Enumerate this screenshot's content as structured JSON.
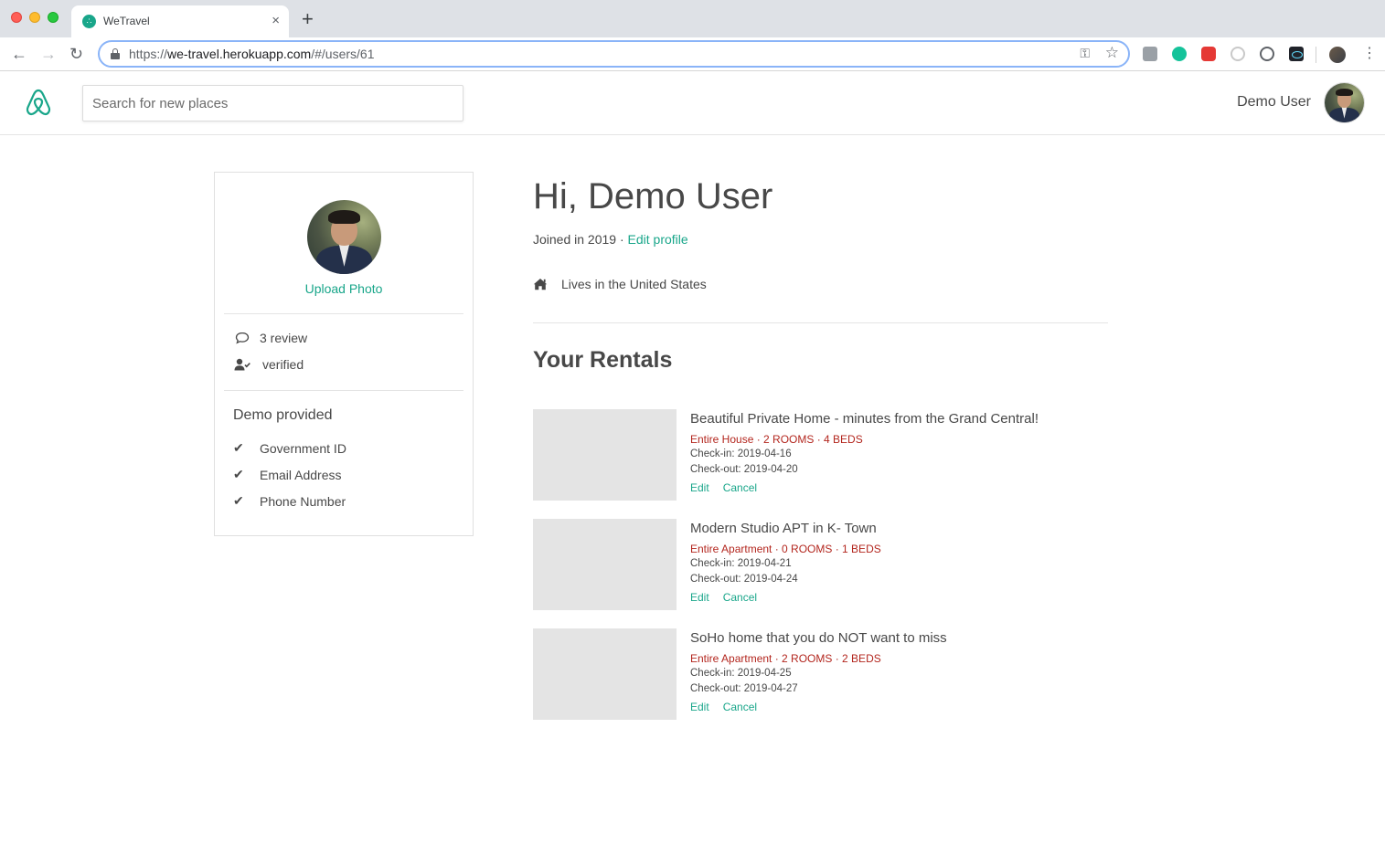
{
  "browser": {
    "tab_title": "WeTravel",
    "tab_close": "×",
    "new_tab": "+",
    "url_scheme": "https://",
    "url_host": "we-travel.herokuapp.com",
    "url_path": "/#/users/61",
    "extensions": [
      "extension-icon",
      "grammarly-icon",
      "youtube-icon",
      "extension-icon",
      "extension-icon",
      "react-devtools-icon"
    ]
  },
  "header": {
    "search_placeholder": "Search for new places",
    "user_name": "Demo User"
  },
  "profile_card": {
    "upload_photo": "Upload Photo",
    "review_count": "3 review",
    "verified": "verified",
    "provided_title": "Demo provided",
    "provided_items": [
      "Government ID",
      "Email Address",
      "Phone Number"
    ]
  },
  "main": {
    "greeting": "Hi, Demo User",
    "joined_text": "Joined in 2019 · ",
    "edit_profile": "Edit profile",
    "lives_in": "Lives in the United States",
    "rentals_title": "Your Rentals",
    "rentals": [
      {
        "title": "Beautiful Private Home - minutes from the Grand Central!",
        "meta": "Entire House · 2 ROOMS · 4 BEDS",
        "check_in": "Check-in: 2019-04-16",
        "check_out": "Check-out: 2019-04-20",
        "edit": "Edit",
        "cancel": "Cancel"
      },
      {
        "title": "Modern Studio APT in K- Town",
        "meta": "Entire Apartment · 0 ROOMS · 1 BEDS",
        "check_in": "Check-in: 2019-04-21",
        "check_out": "Check-out: 2019-04-24",
        "edit": "Edit",
        "cancel": "Cancel"
      },
      {
        "title": "SoHo home that you do NOT want to miss",
        "meta": "Entire Apartment · 2 ROOMS · 2 BEDS",
        "check_in": "Check-in: 2019-04-25",
        "check_out": "Check-out: 2019-04-27",
        "edit": "Edit",
        "cancel": "Cancel"
      }
    ]
  },
  "colors": {
    "accent": "#19a68a",
    "meta_red": "#b3261e",
    "text": "#484848",
    "thumb_placeholder": "#e4e4e4"
  }
}
